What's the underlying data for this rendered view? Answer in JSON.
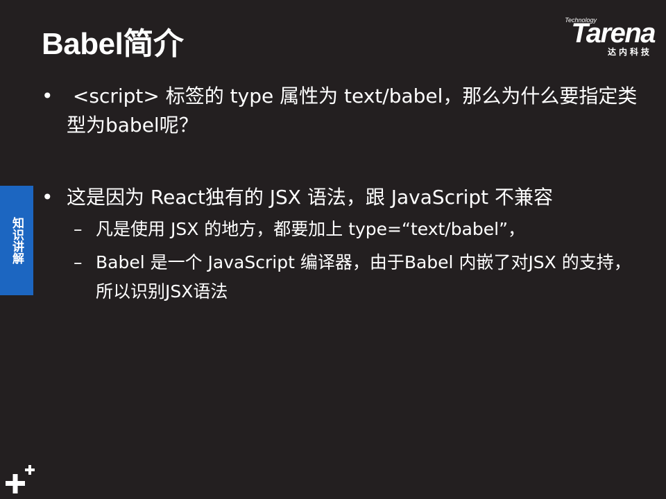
{
  "slide": {
    "title": "Babel简介",
    "side_tab_label": "知识讲解",
    "logo": {
      "tech": "Technology",
      "word": "Tarena",
      "cn": "达内科技"
    },
    "bullets": [
      {
        "marker": "•",
        "text": " <script> 标签的 type 属性为 text/babel，那么为什么要指定类型为babel呢？"
      },
      {
        "marker": "•",
        "text": "这是因为 React独有的 JSX 语法，跟 JavaScript 不兼容",
        "subs": [
          {
            "marker": "–",
            "text": "凡是使用 JSX 的地方，都要加上 type=“text/babel”，"
          },
          {
            "marker": "–",
            "text": "Babel 是一个 JavaScript 编译器，由于Babel 内嵌了对JSX 的支持，所以识别JSX语法"
          }
        ]
      }
    ]
  },
  "colors": {
    "background": "#231f20",
    "text": "#ffffff",
    "side_tab": "#1c66c1"
  },
  "icons": {
    "corner": "plus-sparkle-icon"
  }
}
